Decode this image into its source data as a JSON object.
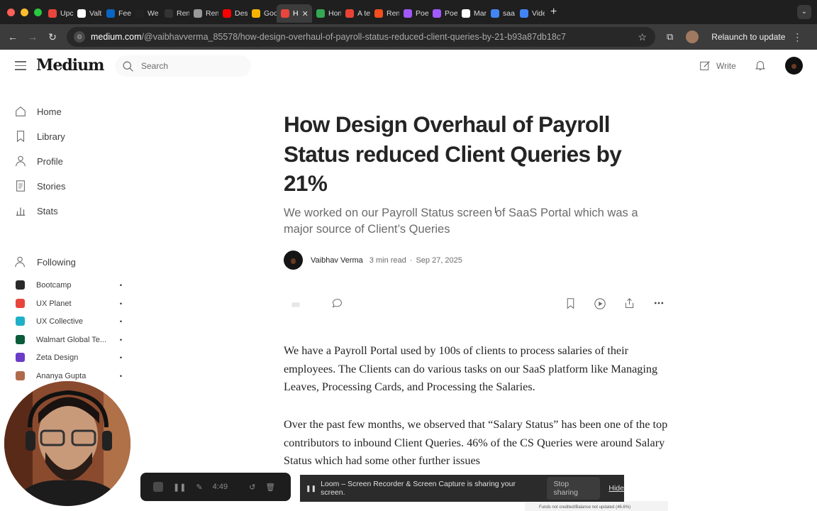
{
  "browser": {
    "tabs": [
      {
        "label": "Upc",
        "color": "#e8453c"
      },
      {
        "label": "Valt",
        "color": "#ffffff"
      },
      {
        "label": "Fee",
        "color": "#0a66c2"
      },
      {
        "label": "We",
        "color": "#222222"
      },
      {
        "label": "Ren",
        "color": "#333333"
      },
      {
        "label": "Ren",
        "color": "#999999"
      },
      {
        "label": "Des",
        "color": "#ff0000"
      },
      {
        "label": "Goo",
        "color": "#f4b400"
      },
      {
        "label": "H",
        "color": "#e8453c",
        "active": true
      },
      {
        "label": "Hon",
        "color": "#34a853"
      },
      {
        "label": "A te",
        "color": "#ea4335"
      },
      {
        "label": "Ren",
        "color": "#f24e1e"
      },
      {
        "label": "Poe",
        "color": "#a259ff"
      },
      {
        "label": "Poe",
        "color": "#a259ff"
      },
      {
        "label": "Man",
        "color": "#ffffff"
      },
      {
        "label": "saa",
        "color": "#4285f4"
      },
      {
        "label": "Vide",
        "color": "#4285f4"
      }
    ],
    "url_host": "medium.com",
    "url_path": "/@vaibhavverma_85578/how-design-overhaul-of-payroll-status-reduced-client-queries-by-21-b93a87db18c7",
    "relaunch_label": "Relaunch to update"
  },
  "header": {
    "logo": "Medium",
    "search_placeholder": "Search",
    "write_label": "Write"
  },
  "sidebar": {
    "nav": [
      {
        "label": "Home",
        "icon": "home-icon"
      },
      {
        "label": "Library",
        "icon": "bookmark-icon"
      },
      {
        "label": "Profile",
        "icon": "user-icon"
      },
      {
        "label": "Stories",
        "icon": "document-icon"
      },
      {
        "label": "Stats",
        "icon": "bar-chart-icon"
      }
    ],
    "following_label": "Following",
    "following": [
      {
        "label": "Bootcamp",
        "color": "#2a2a2a"
      },
      {
        "label": "UX Planet",
        "color": "#e8453c"
      },
      {
        "label": "UX Collective",
        "color": "#1fb0c8"
      },
      {
        "label": "Walmart Global Te...",
        "color": "#0a5c3a"
      },
      {
        "label": "Zeta Design",
        "color": "#6a3cc8"
      },
      {
        "label": "Ananya Gupta",
        "color": "#b06a4a"
      }
    ]
  },
  "article": {
    "title": "How Design Overhaul of Payroll Status reduced Client Queries by 21%",
    "subtitle": "We worked on our Payroll Status screen of SaaS Portal which was a major source of Client’s Queries",
    "author": "Vaibhav Verma",
    "read_time": "3 min read",
    "separator": "·",
    "date": "Sep 27, 2025",
    "paragraphs": [
      "We have a Payroll Portal used by 100s of clients to process salaries of their employees. The Clients can do various tasks on our SaaS platform like Managing Leaves, Processing Cards, and Processing the Salaries.",
      "Over the past few months, we observed that “Salary Status” has been one of the top contributors to inbound Client Queries. 46% of the CS Queries were around Salary Status which had some other further issues"
    ],
    "image_caption_peek": "Funds not credited/Balance not updated (46.6%)"
  },
  "recorder": {
    "timer": "4:49",
    "share_text": "Loom – Screen Recorder & Screen Capture is sharing your screen.",
    "stop_label": "Stop sharing",
    "hide_label": "Hide"
  }
}
